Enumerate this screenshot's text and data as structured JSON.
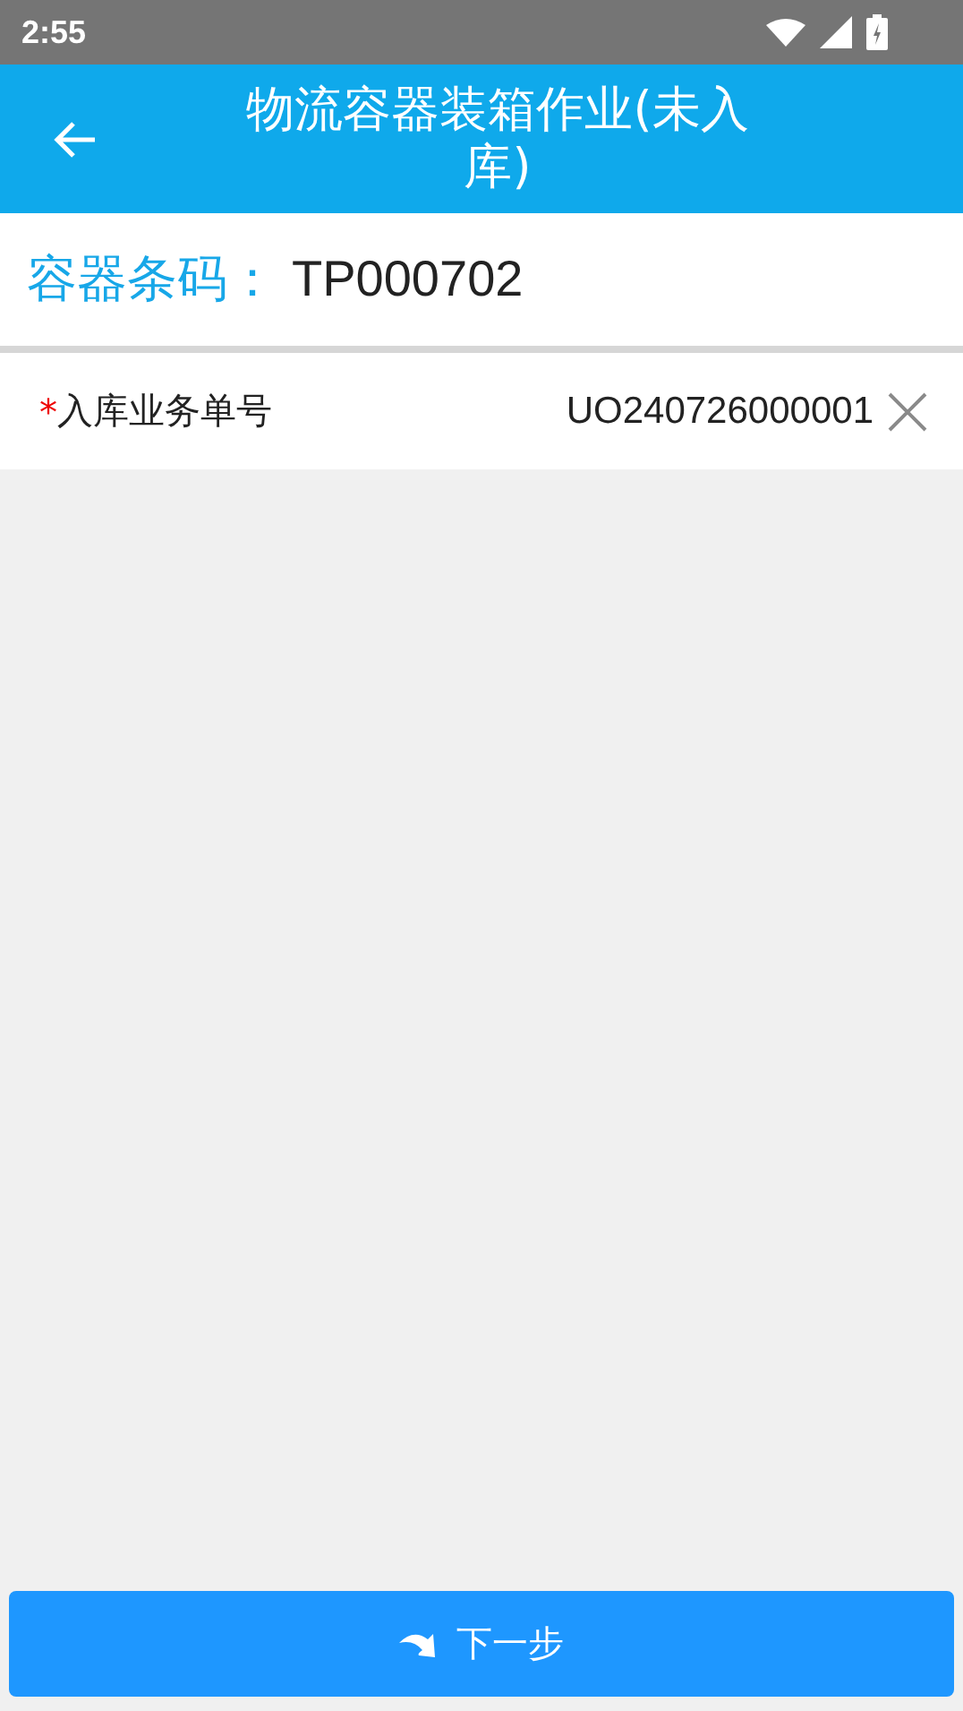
{
  "status_bar": {
    "time": "2:55"
  },
  "header": {
    "title": "物流容器装箱作业(未入库)"
  },
  "container": {
    "label": "容器条码：",
    "value": "TP000702"
  },
  "fields": [
    {
      "required_mark": "*",
      "label": "入库业务单号",
      "value": "UO240726000001"
    }
  ],
  "next_button": {
    "label": "下一步"
  }
}
